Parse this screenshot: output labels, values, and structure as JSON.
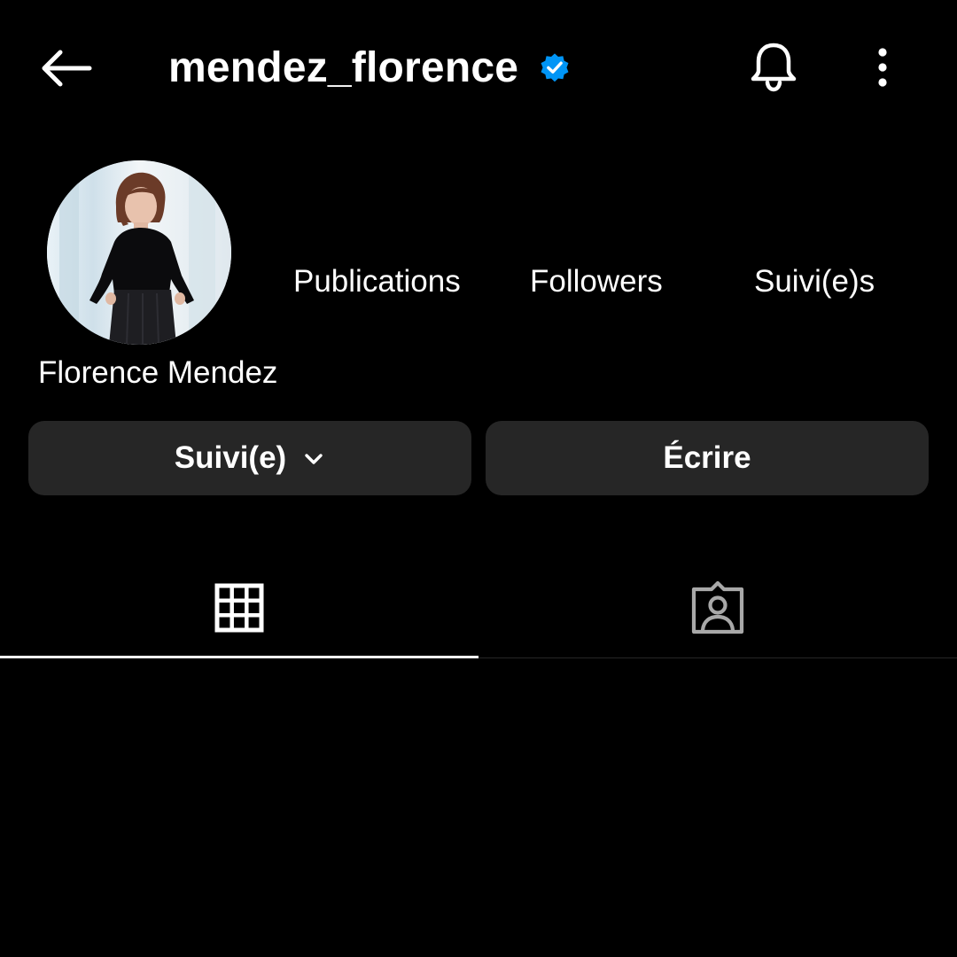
{
  "header": {
    "username": "mendez_florence",
    "verified_badge_icon": "verified-badge-icon",
    "back_icon": "arrow-left-icon",
    "notifications_icon": "bell-icon",
    "more_icon": "more-vertical-icon"
  },
  "profile": {
    "display_name": "Florence Mendez",
    "stats": {
      "publications_label": "Publications",
      "followers_label": "Followers",
      "following_label": "Suivi(e)s"
    }
  },
  "actions": {
    "following_label": "Suivi(e)",
    "following_icon": "chevron-down-icon",
    "message_label": "Écrire"
  },
  "tabs": [
    {
      "icon": "grid-icon",
      "active": true
    },
    {
      "icon": "tagged-person-icon",
      "active": false
    }
  ],
  "colors": {
    "background": "#000000",
    "text": "#ffffff",
    "button_background": "#262626",
    "verified_blue": "#0095f6",
    "inactive_icon": "#a8a8a8"
  }
}
